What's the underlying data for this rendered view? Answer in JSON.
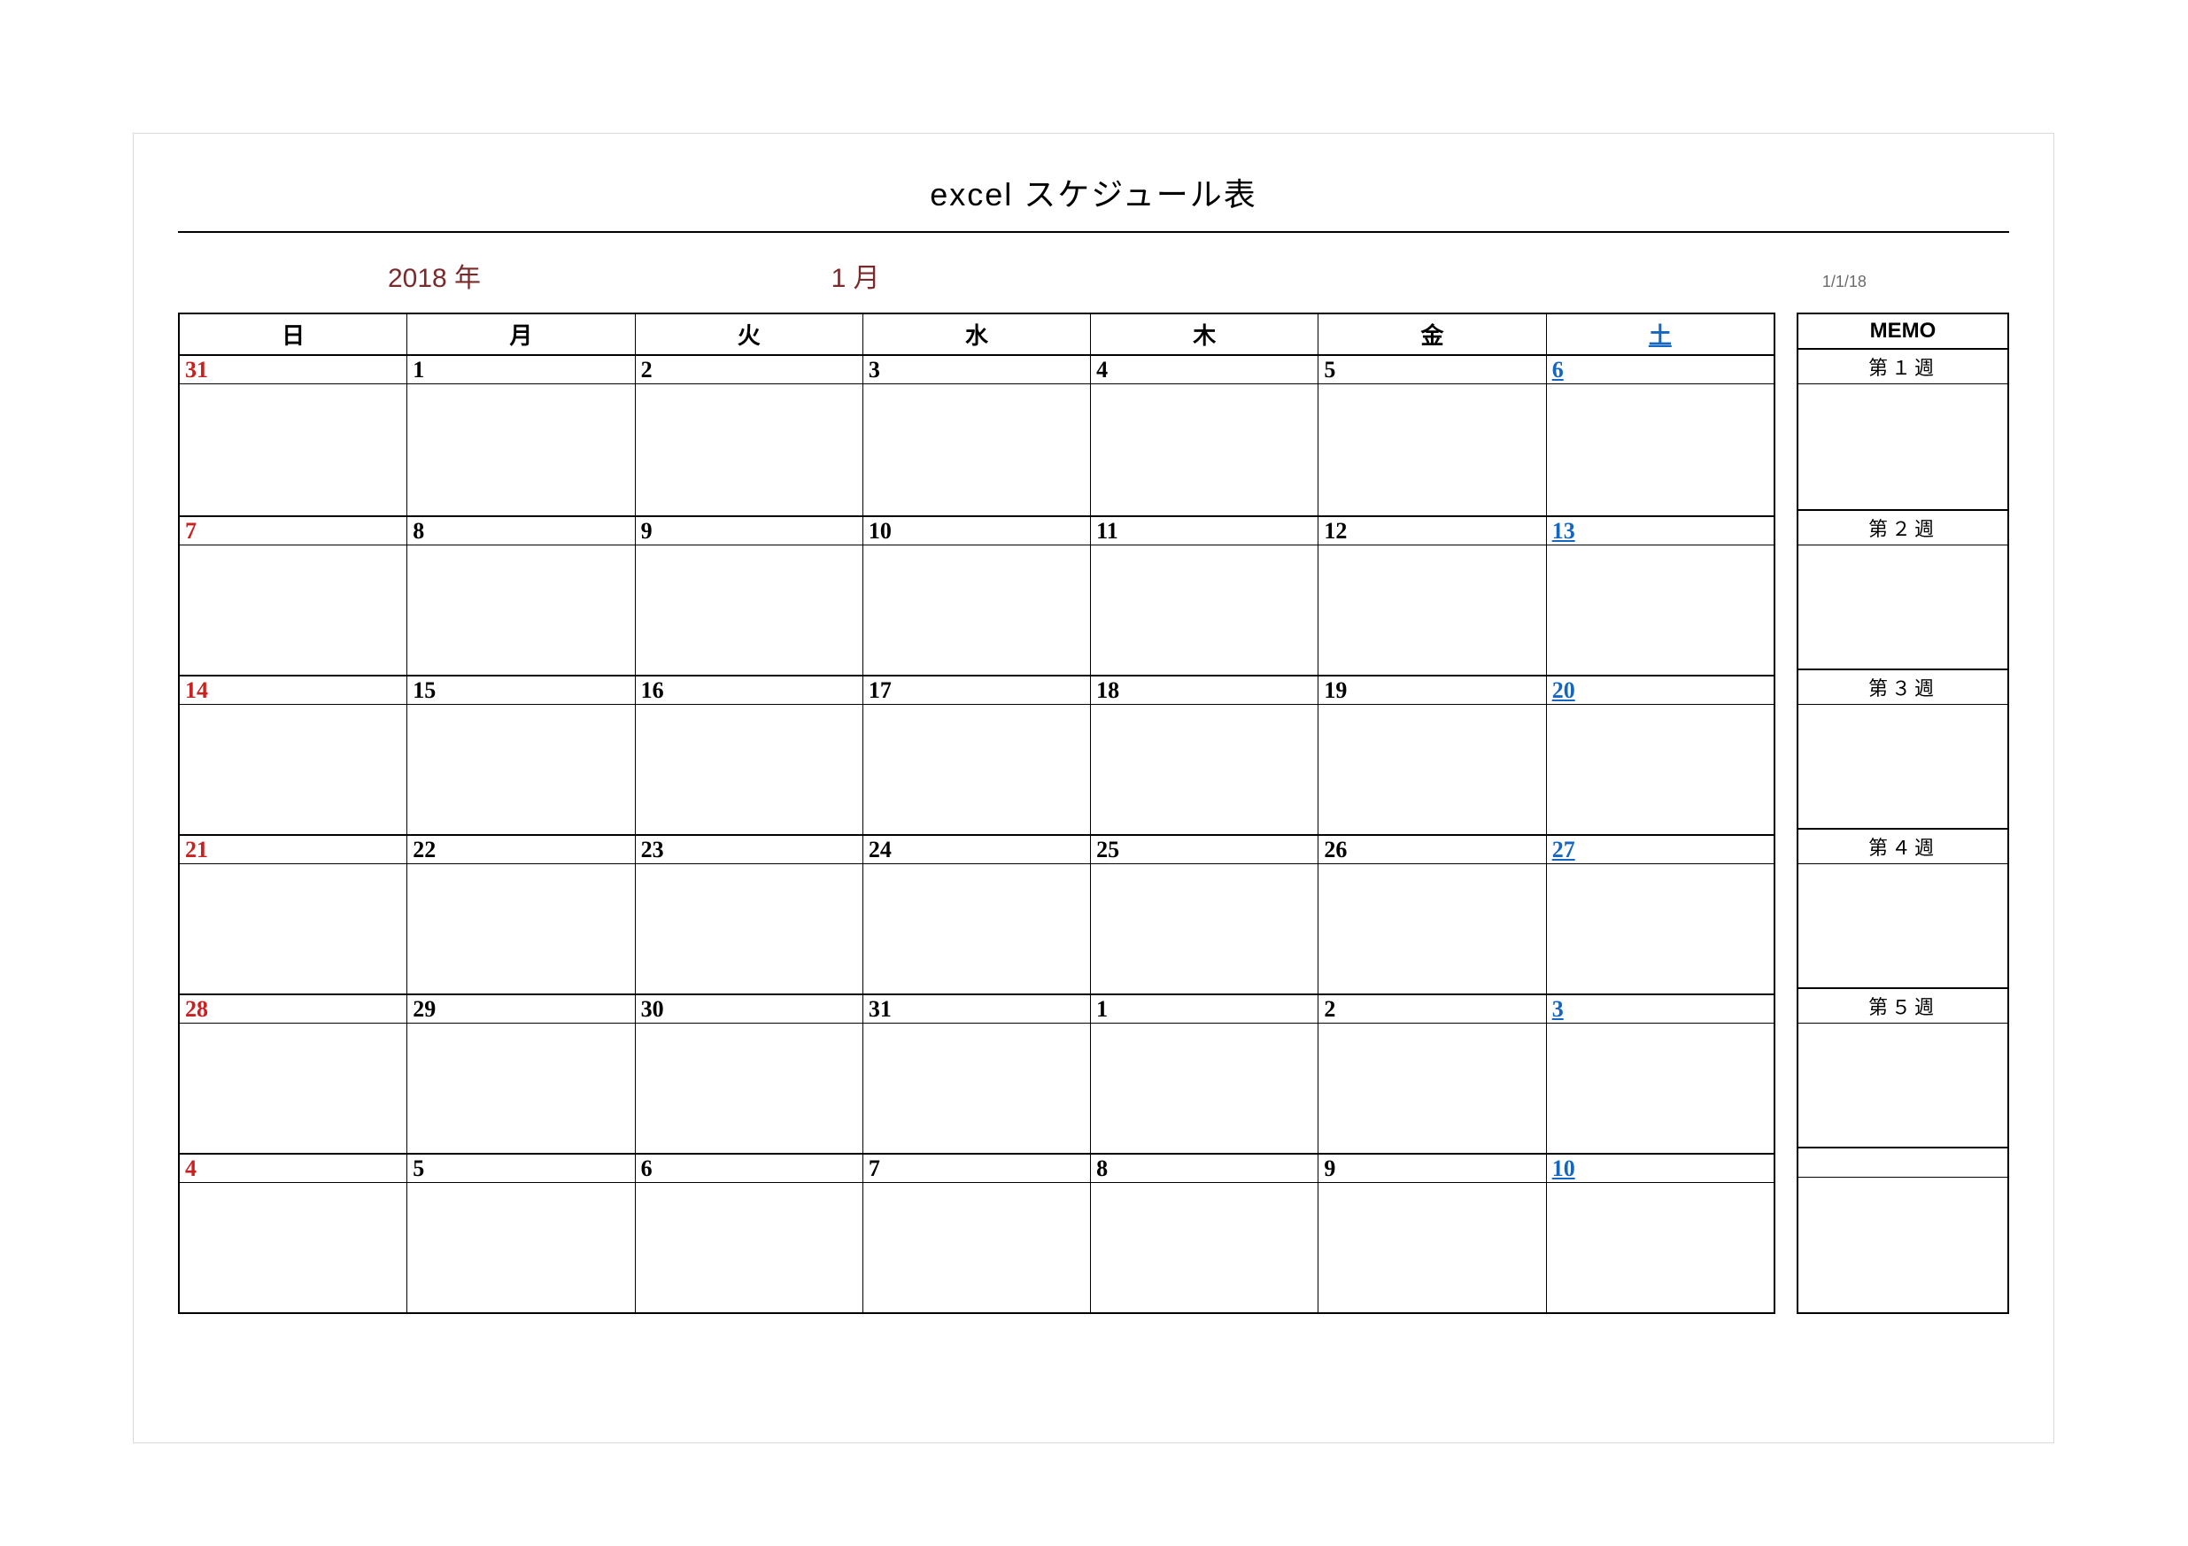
{
  "title": "excel スケジュール表",
  "year_label": "2018 年",
  "month_label": "1 月",
  "date_label": "1/1/18",
  "day_headers": [
    "日",
    "月",
    "火",
    "水",
    "木",
    "金",
    "土"
  ],
  "memo_header": "MEMO",
  "weeks": [
    {
      "label": "第１週",
      "days": [
        {
          "n": "31",
          "cls": "c-sun"
        },
        {
          "n": "1",
          "cls": "c-def"
        },
        {
          "n": "2",
          "cls": "c-def"
        },
        {
          "n": "3",
          "cls": "c-def"
        },
        {
          "n": "4",
          "cls": "c-def"
        },
        {
          "n": "5",
          "cls": "c-def"
        },
        {
          "n": "6",
          "cls": "c-sat"
        }
      ]
    },
    {
      "label": "第２週",
      "days": [
        {
          "n": "7",
          "cls": "c-sun"
        },
        {
          "n": "8",
          "cls": "c-def"
        },
        {
          "n": "9",
          "cls": "c-def"
        },
        {
          "n": "10",
          "cls": "c-def"
        },
        {
          "n": "11",
          "cls": "c-def"
        },
        {
          "n": "12",
          "cls": "c-def"
        },
        {
          "n": "13",
          "cls": "c-sat"
        }
      ]
    },
    {
      "label": "第３週",
      "days": [
        {
          "n": "14",
          "cls": "c-sun"
        },
        {
          "n": "15",
          "cls": "c-def"
        },
        {
          "n": "16",
          "cls": "c-def"
        },
        {
          "n": "17",
          "cls": "c-def"
        },
        {
          "n": "18",
          "cls": "c-def"
        },
        {
          "n": "19",
          "cls": "c-def"
        },
        {
          "n": "20",
          "cls": "c-sat"
        }
      ]
    },
    {
      "label": "第４週",
      "days": [
        {
          "n": "21",
          "cls": "c-sun"
        },
        {
          "n": "22",
          "cls": "c-def"
        },
        {
          "n": "23",
          "cls": "c-def"
        },
        {
          "n": "24",
          "cls": "c-def"
        },
        {
          "n": "25",
          "cls": "c-def"
        },
        {
          "n": "26",
          "cls": "c-def"
        },
        {
          "n": "27",
          "cls": "c-sat"
        }
      ]
    },
    {
      "label": "第５週",
      "days": [
        {
          "n": "28",
          "cls": "c-sun"
        },
        {
          "n": "29",
          "cls": "c-def"
        },
        {
          "n": "30",
          "cls": "c-def"
        },
        {
          "n": "31",
          "cls": "c-def"
        },
        {
          "n": "1",
          "cls": "c-def"
        },
        {
          "n": "2",
          "cls": "c-def"
        },
        {
          "n": "3",
          "cls": "c-sat"
        }
      ]
    },
    {
      "label": "",
      "days": [
        {
          "n": "4",
          "cls": "c-sun"
        },
        {
          "n": "5",
          "cls": "c-def"
        },
        {
          "n": "6",
          "cls": "c-def"
        },
        {
          "n": "7",
          "cls": "c-def"
        },
        {
          "n": "8",
          "cls": "c-def"
        },
        {
          "n": "9",
          "cls": "c-def"
        },
        {
          "n": "10",
          "cls": "c-sat"
        }
      ]
    }
  ]
}
